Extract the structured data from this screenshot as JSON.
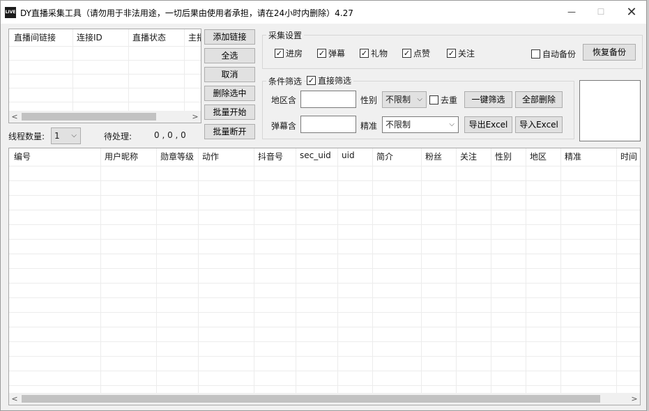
{
  "window": {
    "app_icon_text": "LIVE",
    "title": "DY直播采集工具（请勿用于非法用途，一切后果由使用者承担，请在24小时内删除）4.27",
    "min_glyph": "—",
    "max_glyph": "☐",
    "close_glyph": "✕"
  },
  "room_list": {
    "columns": [
      "直播间链接",
      "连接ID",
      "直播状态",
      "主播"
    ]
  },
  "side_buttons": {
    "add_link": "添加链接",
    "select_all": "全选",
    "cancel": "取消",
    "delete_selected": "删除选中",
    "batch_start": "批量开始",
    "batch_stop": "批量断开"
  },
  "thread": {
    "label": "线程数量:",
    "value": "1",
    "pending_label": "待处理:",
    "pending_value": "0 , 0 , 0"
  },
  "collect_settings": {
    "title": "采集设置",
    "options": [
      {
        "label": "进房",
        "checked": true
      },
      {
        "label": "弹幕",
        "checked": true
      },
      {
        "label": "礼物",
        "checked": true
      },
      {
        "label": "点赞",
        "checked": true
      },
      {
        "label": "关注",
        "checked": true
      }
    ],
    "auto_backup": {
      "label": "自动备份",
      "checked": false
    },
    "restore_backup": "恢复备份"
  },
  "filter": {
    "title": "条件筛选",
    "direct_filter": {
      "label": "直接筛选",
      "checked": true
    },
    "region_label": "地区含",
    "region_value": "",
    "gender_label": "性别",
    "gender_value": "不限制",
    "dedupe": {
      "label": "去重",
      "checked": false
    },
    "one_click_filter": "一键筛选",
    "delete_all": "全部删除",
    "danmu_label": "弹幕含",
    "danmu_value": "",
    "precise_label": "精准",
    "precise_value": "不限制",
    "export_excel": "导出Excel",
    "import_excel": "导入Excel"
  },
  "results": {
    "columns": [
      "编号",
      "用户昵称",
      "勋章等级",
      "动作",
      "抖音号",
      "sec_uid",
      "uid",
      "简介",
      "粉丝",
      "关注",
      "性别",
      "地区",
      "精准",
      "时间"
    ]
  },
  "icons": {
    "check": "✓",
    "chevron_down": "⌵",
    "arrow_left": "<",
    "arrow_right": ">"
  }
}
